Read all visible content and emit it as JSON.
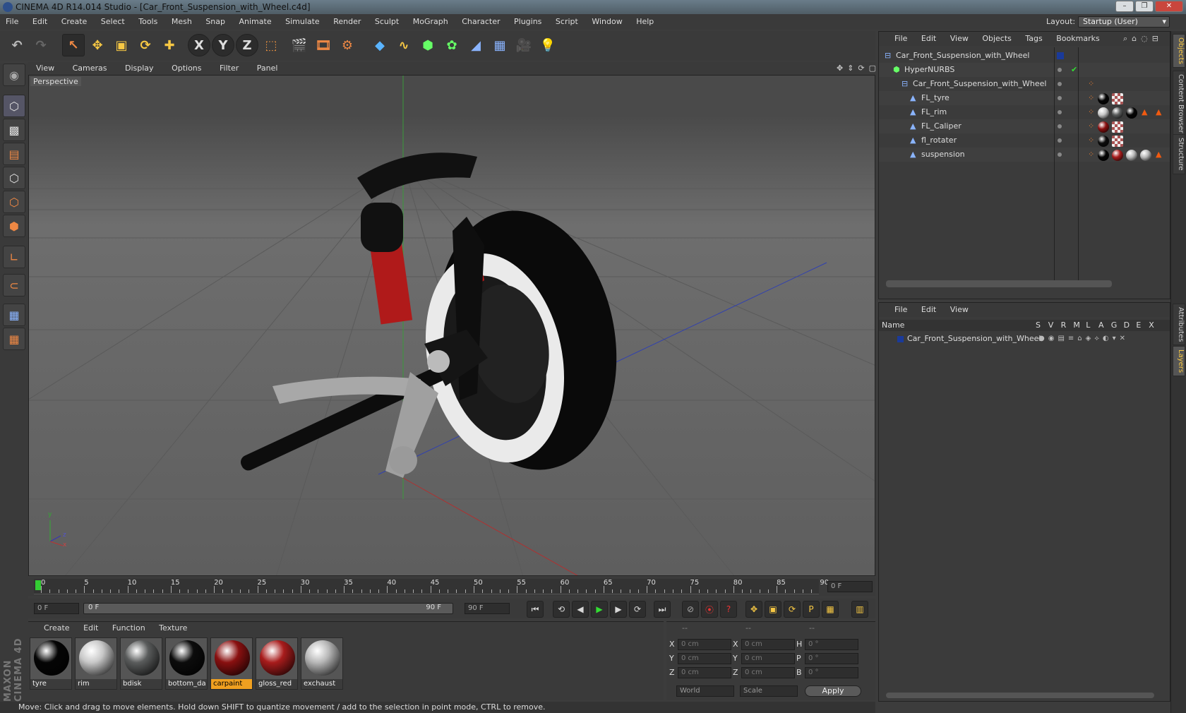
{
  "window": {
    "title": "CINEMA 4D R14.014 Studio - [Car_Front_Suspension_with_Wheel.c4d]",
    "min": "–",
    "max": "❐",
    "close": "✕"
  },
  "menu": {
    "items": [
      "File",
      "Edit",
      "Create",
      "Select",
      "Tools",
      "Mesh",
      "Snap",
      "Animate",
      "Simulate",
      "Render",
      "Sculpt",
      "MoGraph",
      "Character",
      "Plugins",
      "Script",
      "Window",
      "Help"
    ],
    "layout_label": "Layout:",
    "layout_value": "Startup (User)"
  },
  "toolbar": {
    "axis_x": "X",
    "axis_y": "Y",
    "axis_z": "Z"
  },
  "viewport": {
    "menu": [
      "View",
      "Cameras",
      "Display",
      "Options",
      "Filter",
      "Panel"
    ],
    "label": "Perspective",
    "axis_y": "y",
    "axis_x": "x",
    "axis_z": "z"
  },
  "timeline": {
    "ticks": [
      "0",
      "5",
      "10",
      "15",
      "20",
      "25",
      "30",
      "35",
      "40",
      "45",
      "50",
      "55",
      "60",
      "65",
      "70",
      "75",
      "80",
      "85",
      "90"
    ],
    "current_frame": "0 F",
    "start_field": "0 F",
    "range_start": "0 F",
    "range_end": "90 F",
    "end_field": "90 F"
  },
  "materials": {
    "menu": [
      "Create",
      "Edit",
      "Function",
      "Texture"
    ],
    "items": [
      {
        "name": "tyre",
        "color": "#050505",
        "selected": false
      },
      {
        "name": "rim",
        "color": "#c8c8c8",
        "selected": false
      },
      {
        "name": "bdisk",
        "color": "#5a5c5c",
        "selected": false
      },
      {
        "name": "bottom_da",
        "color": "#0c0c0c",
        "selected": false
      },
      {
        "name": "carpaint",
        "color": "#8a1010",
        "selected": true
      },
      {
        "name": "gloss_red",
        "color": "#a81c1c",
        "selected": false
      },
      {
        "name": "exchaust",
        "color": "#b8b8b8",
        "selected": false
      }
    ]
  },
  "coords": {
    "headers": [
      "--",
      "--",
      "--"
    ],
    "rows": [
      {
        "a": "X",
        "av": "0 cm",
        "b": "X",
        "bv": "0 cm",
        "c": "H",
        "cv": "0 °"
      },
      {
        "a": "Y",
        "av": "0 cm",
        "b": "Y",
        "bv": "0 cm",
        "c": "P",
        "cv": "0 °"
      },
      {
        "a": "Z",
        "av": "0 cm",
        "b": "Z",
        "bv": "0 cm",
        "c": "B",
        "cv": "0 °"
      }
    ],
    "world": "World",
    "scale": "Scale",
    "apply": "Apply"
  },
  "status": "Move: Click and drag to move elements. Hold down SHIFT to quantize movement / add to the selection in point mode, CTRL to remove.",
  "objects": {
    "menu": [
      "File",
      "Edit",
      "View",
      "Objects",
      "Tags",
      "Bookmarks"
    ],
    "rows": [
      {
        "name": "Car_Front_Suspension_with_Wheel",
        "indent": 0
      },
      {
        "name": "HyperNURBS",
        "indent": 1
      },
      {
        "name": "Car_Front_Suspension_with_Wheel",
        "indent": 2
      },
      {
        "name": "FL_tyre",
        "indent": 3
      },
      {
        "name": "FL_rim",
        "indent": 3
      },
      {
        "name": "FL_Caliper",
        "indent": 3
      },
      {
        "name": "fl_rotater",
        "indent": 3
      },
      {
        "name": "suspension",
        "indent": 3
      }
    ]
  },
  "layers": {
    "menu": [
      "File",
      "Edit",
      "View"
    ],
    "columns": [
      "Name",
      "S",
      "V",
      "R",
      "M",
      "L",
      "A",
      "G",
      "D",
      "E",
      "X"
    ],
    "row": "Car_Front_Suspension_with_Wheel"
  },
  "side_tabs": [
    "Objects",
    "Content Browser",
    "Structure",
    "Attributes",
    "Layers"
  ],
  "brand": "MAXON CINEMA 4D"
}
